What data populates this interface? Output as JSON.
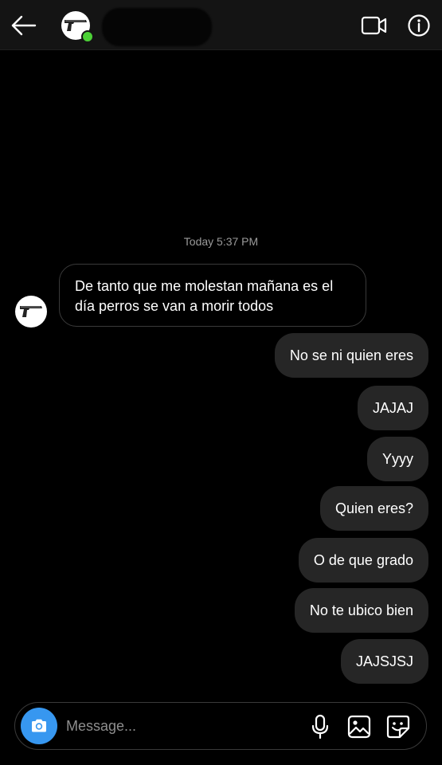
{
  "header": {
    "back_icon": "arrow-left-icon",
    "contact_name": "",
    "online": true,
    "video_icon": "video-camera-icon",
    "info_icon": "info-icon"
  },
  "conversation": {
    "timestamp": "Today 5:37 PM",
    "incoming": [
      {
        "text": "De tanto que me molestan mañana es el día perros se van a morir todos"
      }
    ],
    "outgoing": [
      {
        "text": "No se ni quien eres"
      },
      {
        "text": "JAJAJ"
      },
      {
        "text": "Yyyy"
      },
      {
        "text": "Quien eres?"
      },
      {
        "text": "O de que grado"
      },
      {
        "text": "No te ubico bien"
      },
      {
        "text": "JAJSJSJ"
      }
    ]
  },
  "composer": {
    "placeholder": "Message...",
    "camera_icon": "camera-icon",
    "mic_icon": "microphone-icon",
    "gallery_icon": "gallery-icon",
    "sticker_icon": "sticker-icon"
  },
  "colors": {
    "background": "#000000",
    "header_bg": "#141414",
    "outgoing_bubble": "#262626",
    "accent_blue": "#3797f0",
    "online_green": "#4cd137",
    "timestamp_text": "#9a9a9a"
  }
}
